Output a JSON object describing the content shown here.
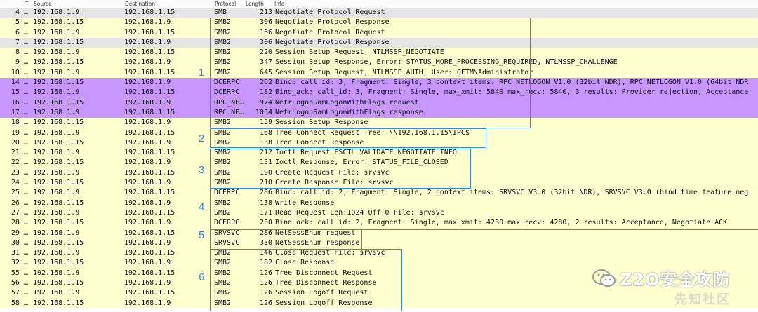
{
  "columns": {
    "no": "T",
    "source": "Source",
    "destination": "Destination",
    "protocol": "Protocol",
    "length": "Length",
    "info": "Info"
  },
  "colors": {
    "smb": "#ffffd0",
    "selected": "#e4e4e4",
    "dcerpc": "#c797ff",
    "annotation": "#2b8cd8"
  },
  "packets": [
    {
      "no": "4 …",
      "source": "192.168.1.9",
      "destination": "192.168.1.15",
      "protocol": "SMB",
      "length": "213",
      "info": "Negotiate Protocol Request",
      "color": "selected"
    },
    {
      "no": "5 …",
      "source": "192.168.1.15",
      "destination": "192.168.1.9",
      "protocol": "SMB2",
      "length": "306",
      "info": "Negotiate Protocol Response",
      "color": "smb"
    },
    {
      "no": "6 …",
      "source": "192.168.1.9",
      "destination": "192.168.1.15",
      "protocol": "SMB2",
      "length": "166",
      "info": "Negotiate Protocol Request",
      "color": "smb"
    },
    {
      "no": "7 …",
      "source": "192.168.1.15",
      "destination": "192.168.1.9",
      "protocol": "SMB2",
      "length": "306",
      "info": "Negotiate Protocol Response",
      "color": "selected"
    },
    {
      "no": "8 …",
      "source": "192.168.1.9",
      "destination": "192.168.1.15",
      "protocol": "SMB2",
      "length": "220",
      "info": "Session Setup Request, NTLMSSP_NEGOTIATE",
      "color": "smb"
    },
    {
      "no": "9 …",
      "source": "192.168.1.15",
      "destination": "192.168.1.9",
      "protocol": "SMB2",
      "length": "347",
      "info": "Session Setup Response, Error: STATUS_MORE_PROCESSING_REQUIRED, NTLMSSP_CHALLENGE",
      "color": "smb"
    },
    {
      "no": "10 …",
      "source": "192.168.1.9",
      "destination": "192.168.1.15",
      "protocol": "SMB2",
      "length": "645",
      "info": "Session Setup Request, NTLMSSP_AUTH, User: QFTM\\Administrator",
      "color": "smb"
    },
    {
      "no": "14 …",
      "source": "192.168.1.15",
      "destination": "192.168.1.9",
      "protocol": "DCERPC",
      "length": "262",
      "info": "Bind: call_id: 3, Fragment: Single, 3 context items: RPC_NETLOGON V1.0 (32bit NDR), RPC_NETLOGON V1.0 (64bit NDR",
      "color": "dcerpc"
    },
    {
      "no": "15 …",
      "source": "192.168.1.9",
      "destination": "192.168.1.15",
      "protocol": "DCERPC",
      "length": "182",
      "info": "Bind_ack: call_id: 3, Fragment: Single, max_xmit: 5840 max_recv: 5840, 3 results: Provider rejection, Acceptance",
      "color": "dcerpc"
    },
    {
      "no": "16 …",
      "source": "192.168.1.15",
      "destination": "192.168.1.9",
      "protocol": "RPC_NE…",
      "length": "974",
      "info": "NetrLogonSamLogonWithFlags request",
      "color": "dcerpc"
    },
    {
      "no": "17 …",
      "source": "192.168.1.9",
      "destination": "192.168.1.15",
      "protocol": "RPC_NE…",
      "length": "1054",
      "info": "NetrLogonSamLogonWithFlags response",
      "color": "dcerpc"
    },
    {
      "no": "18 …",
      "source": "192.168.1.15",
      "destination": "192.168.1.9",
      "protocol": "SMB2",
      "length": "159",
      "info": "Session Setup Response",
      "color": "smb"
    },
    {
      "no": "19 …",
      "source": "192.168.1.9",
      "destination": "192.168.1.15",
      "protocol": "SMB2",
      "length": "168",
      "info": "Tree Connect Request Tree: \\\\192.168.1.15\\IPC$",
      "color": "smb"
    },
    {
      "no": "20 …",
      "source": "192.168.1.15",
      "destination": "192.168.1.9",
      "protocol": "SMB2",
      "length": "138",
      "info": "Tree Connect Response",
      "color": "smb"
    },
    {
      "no": "21 …",
      "source": "192.168.1.9",
      "destination": "192.168.1.15",
      "protocol": "SMB2",
      "length": "212",
      "info": "Ioctl Request FSCTL_VALIDATE_NEGOTIATE_INFO",
      "color": "smb"
    },
    {
      "no": "22 …",
      "source": "192.168.1.15",
      "destination": "192.168.1.9",
      "protocol": "SMB2",
      "length": "131",
      "info": "Ioctl Response, Error: STATUS_FILE_CLOSED",
      "color": "smb"
    },
    {
      "no": "23 …",
      "source": "192.168.1.9",
      "destination": "192.168.1.15",
      "protocol": "SMB2",
      "length": "190",
      "info": "Create Request File: srvsvc",
      "color": "smb"
    },
    {
      "no": "24 …",
      "source": "192.168.1.15",
      "destination": "192.168.1.9",
      "protocol": "SMB2",
      "length": "210",
      "info": "Create Response File: srvsvc",
      "color": "smb"
    },
    {
      "no": "25 …",
      "source": "192.168.1.9",
      "destination": "192.168.1.15",
      "protocol": "DCERPC",
      "length": "286",
      "info": "Bind: call_id: 2, Fragment: Single, 2 context items: SRVSVC V3.0 (32bit NDR), SRVSVC V3.0 (bind time feature neg",
      "color": "smb"
    },
    {
      "no": "26 …",
      "source": "192.168.1.15",
      "destination": "192.168.1.9",
      "protocol": "SMB2",
      "length": "138",
      "info": "Write Response",
      "color": "smb"
    },
    {
      "no": "27 …",
      "source": "192.168.1.9",
      "destination": "192.168.1.15",
      "protocol": "SMB2",
      "length": "171",
      "info": "Read Request Len:1024 Off:0 File: srvsvc",
      "color": "smb"
    },
    {
      "no": "28 …",
      "source": "192.168.1.15",
      "destination": "192.168.1.9",
      "protocol": "DCERPC",
      "length": "230",
      "info": "Bind_ack: call_id: 2, Fragment: Single, max_xmit: 4280 max_recv: 4280, 2 results: Acceptance, Negotiate ACK",
      "color": "smb"
    },
    {
      "no": "29 …",
      "source": "192.168.1.9",
      "destination": "192.168.1.15",
      "protocol": "SRVSVC",
      "length": "286",
      "info": "NetSessEnum request",
      "color": "smb"
    },
    {
      "no": "30 …",
      "source": "192.168.1.15",
      "destination": "192.168.1.9",
      "protocol": "SRVSVC",
      "length": "330",
      "info": "NetSessEnum response",
      "color": "smb"
    },
    {
      "no": "31 …",
      "source": "192.168.1.9",
      "destination": "192.168.1.15",
      "protocol": "SMB2",
      "length": "146",
      "info": "Close Request File: srvsvc",
      "color": "smb"
    },
    {
      "no": "32 …",
      "source": "192.168.1.15",
      "destination": "192.168.1.9",
      "protocol": "SMB2",
      "length": "182",
      "info": "Close Response",
      "color": "smb"
    },
    {
      "no": "55 …",
      "source": "192.168.1.9",
      "destination": "192.168.1.15",
      "protocol": "SMB2",
      "length": "126",
      "info": "Tree Disconnect Request",
      "color": "smb"
    },
    {
      "no": "56 …",
      "source": "192.168.1.15",
      "destination": "192.168.1.9",
      "protocol": "SMB2",
      "length": "126",
      "info": "Tree Disconnect Response",
      "color": "smb"
    },
    {
      "no": "57 …",
      "source": "192.168.1.9",
      "destination": "192.168.1.15",
      "protocol": "SMB2",
      "length": "126",
      "info": "Session Logoff Request",
      "color": "smb"
    },
    {
      "no": "58 …",
      "source": "192.168.1.15",
      "destination": "192.168.1.9",
      "protocol": "SMB2",
      "length": "126",
      "info": "Session Logoff Response",
      "color": "smb"
    }
  ],
  "annotations": [
    {
      "label": "1",
      "rows": "5–18"
    },
    {
      "label": "2",
      "rows": "19–20"
    },
    {
      "label": "3",
      "rows": "21–24"
    },
    {
      "label": "4",
      "rows": "25–28"
    },
    {
      "label": "5",
      "rows": "29–30"
    },
    {
      "label": "6",
      "rows": "31–58"
    }
  ],
  "watermark": {
    "brand": "Z2O安全攻防",
    "sub": "先知社区"
  }
}
